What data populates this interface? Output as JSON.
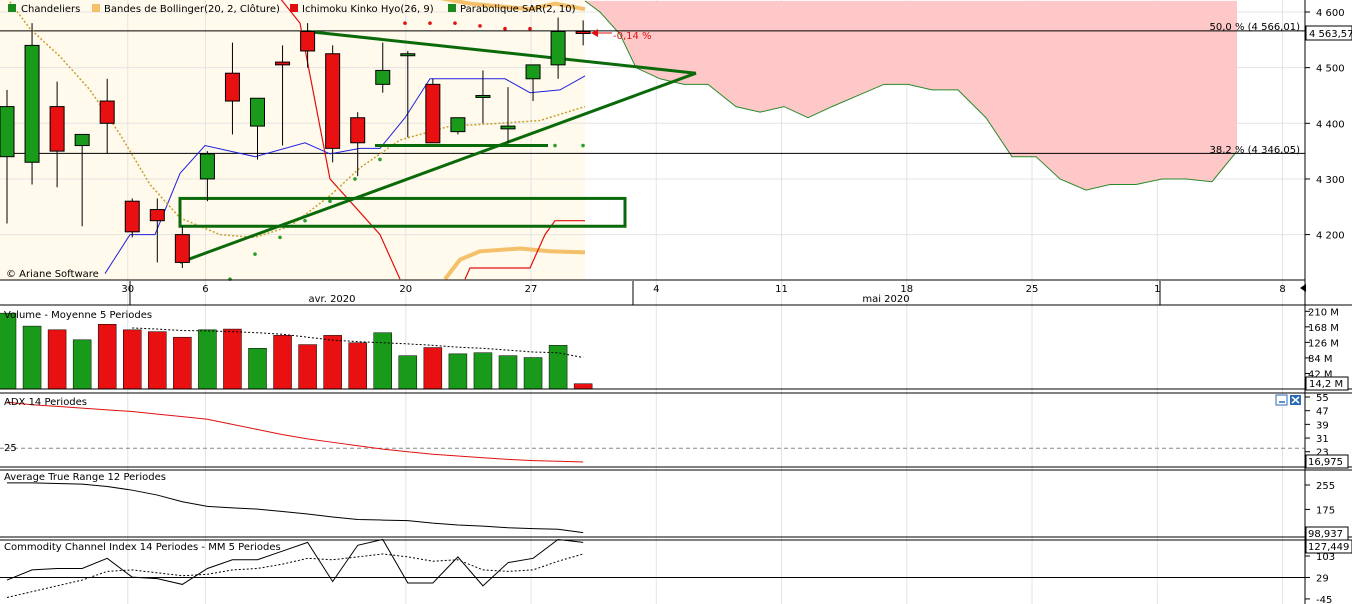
{
  "legend": {
    "items": [
      {
        "label": "Chandeliers",
        "color": "#1a8a1a"
      },
      {
        "label": "Bandes de Bollinger(20, 2, Clôture)",
        "color": "#f4c06a"
      },
      {
        "label": "Ichimoku Kinko Hyo(26, 9)",
        "color": "#e01010"
      },
      {
        "label": "Parabolique SAR(2, 10)",
        "color": "#1a8a1a"
      }
    ]
  },
  "copyright": "© Ariane Software",
  "colors": {
    "up": "#1a9a1a",
    "down": "#e81010",
    "cloud": "#ffc8c8",
    "trend": "#0a6a0a",
    "sar": "#2aa02a",
    "boll": "#f4c06a",
    "kijun": "#e01010",
    "tenkan": "#2020e0",
    "chikou": "#c8a030",
    "span": "#2a8a2a"
  },
  "chart_data": [
    {
      "type": "candlestick",
      "name": "main",
      "y_ticks": [
        "4 600",
        "4 500",
        "4 400",
        "4 300",
        "4 200"
      ],
      "y_tick_values": [
        4600,
        4500,
        4400,
        4300,
        4200
      ],
      "ylim": [
        4120,
        4620
      ],
      "x_ticks": [
        "30",
        "6",
        "20",
        "27",
        "4",
        "11",
        "18",
        "25",
        "1",
        "8"
      ],
      "x_month_labels": [
        "avr. 2020",
        "mai 2020"
      ],
      "fib_levels": [
        {
          "label": "50,0 % (4 566,01)",
          "value": 4566.01
        },
        {
          "label": "38,2 % (4 346,05)",
          "value": 4346.05
        }
      ],
      "last_price_label": "4 563,57",
      "change_label": "-0,14 %",
      "candles": [
        {
          "o": 4340,
          "h": 4460,
          "l": 4220,
          "c": 4430
        },
        {
          "o": 4330,
          "h": 4580,
          "l": 4290,
          "c": 4540
        },
        {
          "o": 4430,
          "h": 4475,
          "l": 4285,
          "c": 4350
        },
        {
          "o": 4360,
          "h": 4380,
          "l": 4215,
          "c": 4380
        },
        {
          "o": 4440,
          "h": 4480,
          "l": 4345,
          "c": 4400
        },
        {
          "o": 4260,
          "h": 4265,
          "l": 4195,
          "c": 4205
        },
        {
          "o": 4245,
          "h": 4265,
          "l": 4150,
          "c": 4225
        },
        {
          "o": 4200,
          "h": 4215,
          "l": 4140,
          "c": 4150
        },
        {
          "o": 4300,
          "h": 4350,
          "l": 4260,
          "c": 4345
        },
        {
          "o": 4490,
          "h": 4545,
          "l": 4380,
          "c": 4440
        },
        {
          "o": 4395,
          "h": 4445,
          "l": 4335,
          "c": 4445
        },
        {
          "o": 4510,
          "h": 4540,
          "l": 4360,
          "c": 4505
        },
        {
          "o": 4565,
          "h": 4580,
          "l": 4500,
          "c": 4530
        },
        {
          "o": 4525,
          "h": 4540,
          "l": 4330,
          "c": 4355
        },
        {
          "o": 4410,
          "h": 4420,
          "l": 4305,
          "c": 4365
        },
        {
          "o": 4470,
          "h": 4545,
          "l": 4455,
          "c": 4495
        },
        {
          "o": 4525,
          "h": 4530,
          "l": 4375,
          "c": 4525
        },
        {
          "o": 4470,
          "h": 4480,
          "l": 4365,
          "c": 4365
        },
        {
          "o": 4385,
          "h": 4410,
          "l": 4380,
          "c": 4410
        },
        {
          "o": 4450,
          "h": 4495,
          "l": 4400,
          "c": 4450
        },
        {
          "o": 4390,
          "h": 4465,
          "l": 4365,
          "c": 4395
        },
        {
          "o": 4480,
          "h": 4505,
          "l": 4440,
          "c": 4505
        },
        {
          "o": 4505,
          "h": 4590,
          "l": 4480,
          "c": 4565
        },
        {
          "o": 4565,
          "h": 4585,
          "l": 4540,
          "c": 4563.57
        }
      ]
    },
    {
      "type": "bar",
      "name": "volume",
      "title": "Volume  - Moyenne 5 Periodes",
      "y_ticks": [
        "210 M",
        "168 M",
        "126 M",
        "84 M",
        "42 M"
      ],
      "y_tick_values": [
        210,
        168,
        126,
        84,
        42
      ],
      "last_label": "14,2 M",
      "values": [
        205,
        170,
        160,
        133,
        175,
        160,
        155,
        140,
        160,
        162,
        110,
        145,
        120,
        145,
        125,
        152,
        90,
        112,
        95,
        98,
        90,
        85,
        118,
        14.2
      ],
      "ma_values": [
        null,
        null,
        null,
        null,
        null,
        165,
        162,
        158,
        157,
        155,
        152,
        148,
        140,
        132,
        128,
        125,
        122,
        118,
        113,
        110,
        105,
        100,
        98,
        85
      ]
    },
    {
      "type": "line",
      "name": "adx",
      "title": "ADX 14 Periodes",
      "y_ticks": [
        "55",
        "47",
        "39",
        "31",
        "23"
      ],
      "y_tick_values": [
        55,
        47,
        39,
        31,
        23
      ],
      "reference_label": "25",
      "reference_value": 25,
      "last_label": "16,975",
      "values": [
        52,
        50.5,
        49.5,
        48.5,
        47.5,
        46.5,
        45,
        43.5,
        42,
        39,
        36,
        33,
        30.5,
        28.5,
        26.5,
        24.5,
        23,
        21.5,
        20.5,
        19.5,
        18.5,
        17.8,
        17.4,
        17.0
      ]
    },
    {
      "type": "line",
      "name": "atr",
      "title": "Average True Range 12 Periodes",
      "y_ticks": [
        "255",
        "175"
      ],
      "y_tick_values": [
        255,
        175
      ],
      "last_label": "98,937",
      "values": [
        262,
        262,
        260,
        258,
        250,
        238,
        222,
        200,
        185,
        180,
        176,
        168,
        160,
        150,
        142,
        140,
        138,
        130,
        124,
        120,
        115,
        112,
        110,
        98.9
      ]
    },
    {
      "type": "line",
      "name": "cci",
      "title": "Commodity Channel Index 14 Periodes - MM  5 Periodes",
      "y_ticks": [
        "103",
        "29",
        "-45"
      ],
      "y_tick_values": [
        103,
        29,
        -45
      ],
      "last_label": "127,449",
      "values": [
        20,
        55,
        60,
        60,
        95,
        30,
        25,
        5,
        60,
        90,
        90,
        120,
        150,
        15,
        140,
        160,
        10,
        10,
        100,
        0,
        80,
        95,
        160,
        150
      ],
      "ma_values": [
        -40,
        -20,
        0,
        20,
        50,
        55,
        45,
        35,
        40,
        55,
        60,
        75,
        95,
        90,
        100,
        110,
        100,
        85,
        90,
        55,
        50,
        55,
        85,
        110
      ]
    }
  ]
}
